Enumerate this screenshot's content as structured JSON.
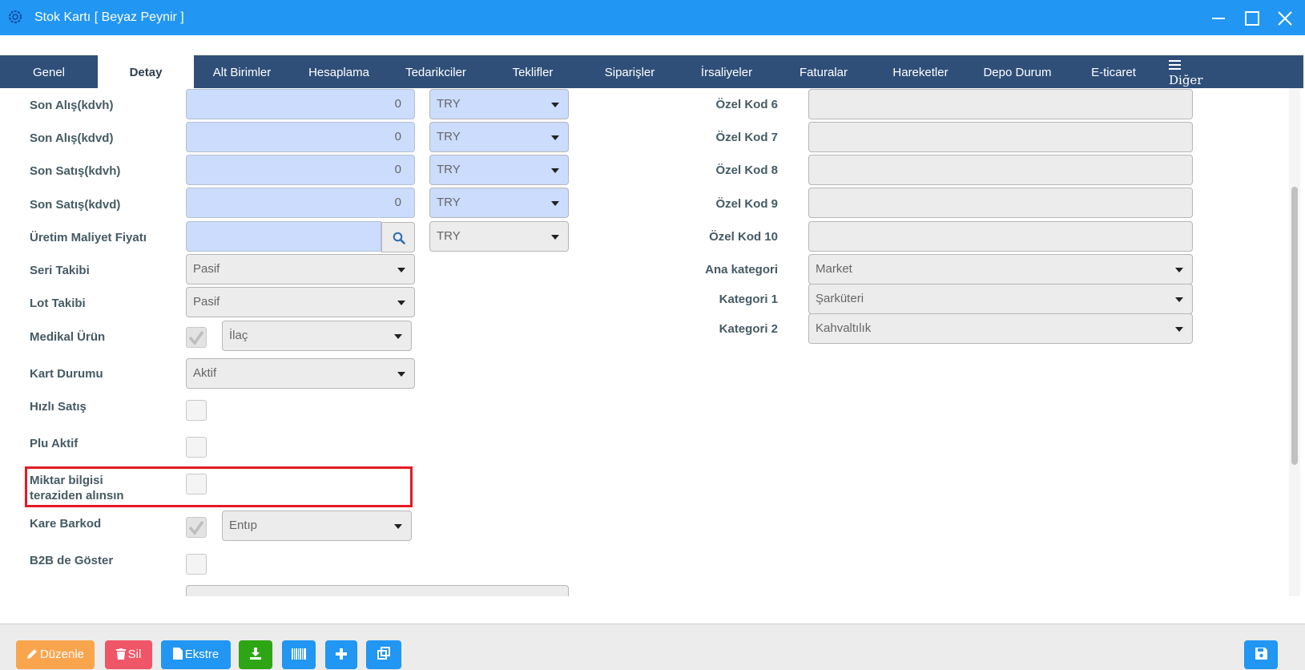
{
  "window": {
    "title": "Stok Kartı [ Beyaz Peynir ]"
  },
  "tabs": [
    {
      "label": "Genel"
    },
    {
      "label": "Detay"
    },
    {
      "label": "Alt Birimler"
    },
    {
      "label": "Hesaplama"
    },
    {
      "label": "Tedarikciler"
    },
    {
      "label": "Teklifler"
    },
    {
      "label": "Siparişler"
    },
    {
      "label": "İrsaliyeler"
    },
    {
      "label": "Faturalar"
    },
    {
      "label": "Hareketler"
    },
    {
      "label": "Depo Durum"
    },
    {
      "label": "E-ticaret"
    }
  ],
  "active_tab": "Detay",
  "more_tab": {
    "label": "Diğer",
    "icon": "hamburger-icon"
  },
  "left_fields": {
    "son_alis_kdvh": {
      "label": "Son Alış(kdvh)",
      "value": "0",
      "currency": "TRY"
    },
    "son_alis_kdvd": {
      "label": "Son Alış(kdvd)",
      "value": "0",
      "currency": "TRY"
    },
    "son_satis_kdvh": {
      "label": "Son Satış(kdvh)",
      "value": "0",
      "currency": "TRY"
    },
    "son_satis_kdvd": {
      "label": "Son Satış(kdvd)",
      "value": "0",
      "currency": "TRY"
    },
    "uretim_maliyet": {
      "label": "Üretim Maliyet Fiyatı",
      "value": "",
      "currency": "TRY"
    },
    "seri_takibi": {
      "label": "Seri Takibi",
      "value": "Pasif"
    },
    "lot_takibi": {
      "label": "Lot Takibi",
      "value": "Pasif"
    },
    "medikal_urun": {
      "label": "Medikal Ürün",
      "checked": true,
      "value": "İlaç"
    },
    "kart_durumu": {
      "label": "Kart Durumu",
      "value": "Aktif"
    },
    "hizli_satis": {
      "label": "Hızlı Satış",
      "checked": false
    },
    "plu_aktif": {
      "label": "Plu Aktif",
      "checked": false
    },
    "miktar_terazi": {
      "label_line1": "Miktar bilgisi",
      "label_line2": "teraziden alınsın",
      "checked": false
    },
    "kare_barkod": {
      "label": "Kare Barkod",
      "checked": true,
      "value": "Entıp"
    },
    "b2b_goster": {
      "label": "B2B de Göster",
      "checked": false
    }
  },
  "right_fields": {
    "ozel_kod_6": {
      "label": "Özel Kod 6",
      "value": ""
    },
    "ozel_kod_7": {
      "label": "Özel Kod 7",
      "value": ""
    },
    "ozel_kod_8": {
      "label": "Özel Kod 8",
      "value": ""
    },
    "ozel_kod_9": {
      "label": "Özel Kod 9",
      "value": ""
    },
    "ozel_kod_10": {
      "label": "Özel Kod 10",
      "value": ""
    },
    "ana_kategori": {
      "label": "Ana kategori",
      "value": "Market"
    },
    "kategori_1": {
      "label": "Kategori 1",
      "value": "Şarküteri"
    },
    "kategori_2": {
      "label": "Kategori 2",
      "value": "Kahvaltılık"
    }
  },
  "footer": {
    "edit_label": "Düzenle",
    "delete_label": "Sil",
    "extract_label": "Ekstre"
  },
  "colors": {
    "titlebar": "#2196f3",
    "tabbar": "#2f4f79",
    "highlight": "#e41b23",
    "edit_btn": "#f9a54d",
    "delete_btn": "#ef5768",
    "blue_btn": "#2196f3",
    "green_btn": "#2ea515"
  }
}
